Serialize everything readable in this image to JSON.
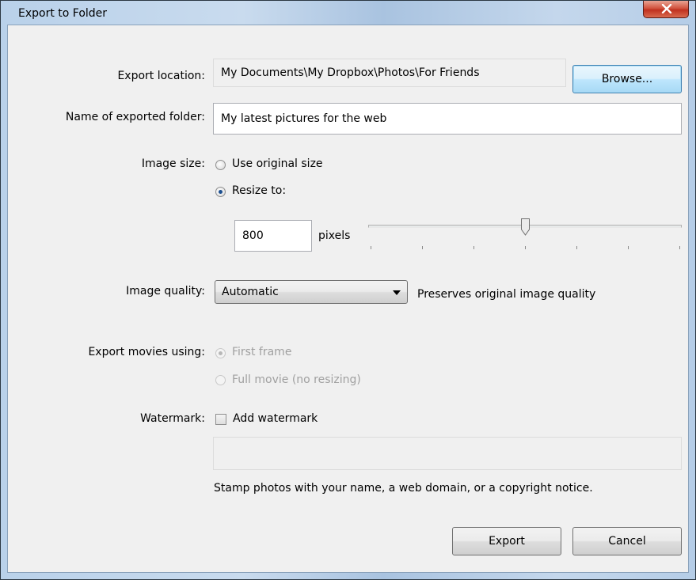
{
  "window": {
    "title": "Export to Folder"
  },
  "export_location": {
    "label": "Export location:",
    "value": "My Documents\\My Dropbox\\Photos\\For Friends",
    "browse_label": "Browse..."
  },
  "folder_name": {
    "label": "Name of exported folder:",
    "value": "My latest pictures for the web"
  },
  "image_size": {
    "label": "Image size:",
    "options": [
      {
        "label": "Use original size",
        "checked": false
      },
      {
        "label": "Resize to:",
        "checked": true
      }
    ],
    "pixels_value": "800",
    "pixels_unit": "pixels",
    "slider_fraction": 0.5,
    "slider_ticks": 7
  },
  "image_quality": {
    "label": "Image quality:",
    "selected": "Automatic",
    "description": "Preserves original image quality"
  },
  "export_movies": {
    "label": "Export movies using:",
    "options": [
      {
        "label": "First frame",
        "checked": true
      },
      {
        "label": "Full movie (no resizing)",
        "checked": false
      }
    ]
  },
  "watermark": {
    "label": "Watermark:",
    "checkbox_label": "Add watermark",
    "checked": false,
    "text_value": "",
    "help": "Stamp photos with your name, a web domain, or a copyright notice."
  },
  "actions": {
    "export_label": "Export",
    "cancel_label": "Cancel"
  }
}
